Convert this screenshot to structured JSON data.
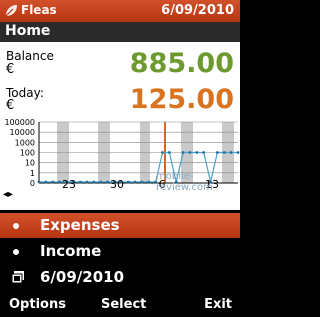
{
  "statusbar": {
    "app_title": "Fleas",
    "date": "6/09/2010",
    "logo_icon": "leaf-icon"
  },
  "header": {
    "title": "Home"
  },
  "summary": {
    "balance": {
      "label": "Balance",
      "currency": "€",
      "value": "885.00"
    },
    "today": {
      "label": "Today:",
      "currency": "€",
      "value": "125.00"
    }
  },
  "chart_data": {
    "type": "line",
    "y_scale": "log",
    "y_tick_labels": [
      "100000",
      "10000",
      "1000",
      "100",
      "10",
      "1",
      "0"
    ],
    "x_tick_labels": [
      "23",
      "30",
      "6",
      "13"
    ],
    "series": [
      {
        "values": [
          0,
          0,
          0,
          0,
          0,
          0,
          0,
          0,
          0,
          0,
          0,
          0,
          0,
          0,
          0,
          0,
          0,
          0,
          100,
          100,
          0,
          100,
          100,
          100,
          100,
          0,
          100,
          100,
          100,
          100
        ]
      }
    ],
    "highlight_label": "6"
  },
  "nav": {
    "arrows": "◂▸"
  },
  "watermark": "mobile-review.com",
  "menu": {
    "items": [
      {
        "label": "Expenses",
        "selected": true,
        "icon": "bullet-icon"
      },
      {
        "label": "Income",
        "selected": false,
        "icon": "bullet-icon"
      },
      {
        "label": "6/09/2010",
        "selected": false,
        "icon": "calendar-icon"
      }
    ]
  },
  "softkeys": {
    "left": "Options",
    "center": "Select",
    "right": "Exit"
  }
}
